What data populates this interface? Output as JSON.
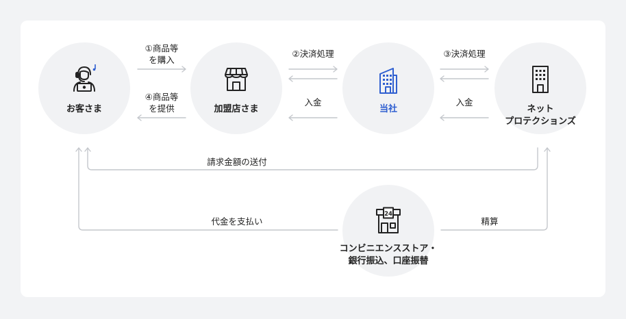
{
  "nodes": {
    "customer": "お客さま",
    "merchant": "加盟店さま",
    "company": "当社",
    "netprotections_line1": "ネット",
    "netprotections_line2": "プロテクションズ",
    "convenience_line1": "コンビニエンスストア・",
    "convenience_line2": "銀行振込、口座振替"
  },
  "flows": {
    "step1_line1": "①商品等",
    "step1_line2": "を購入",
    "step4_line1": "④商品等",
    "step4_line2": "を提供",
    "step2": "②決済処理",
    "step3": "③決済処理",
    "deposit_left": "入金",
    "deposit_right": "入金",
    "invoice": "請求金額の送付",
    "payment": "代金を支払い",
    "settlement": "精算"
  },
  "icons": {
    "customer": "operator-headset-icon",
    "merchant": "storefront-icon",
    "company": "office-building-icon",
    "netprotections": "building-icon",
    "convenience": "convenience-store-24-icon"
  },
  "colors": {
    "accent": "#2f5fd0",
    "arrow": "#c4c7cc",
    "circle": "#f1f2f4",
    "background": "#f2f3f5"
  }
}
